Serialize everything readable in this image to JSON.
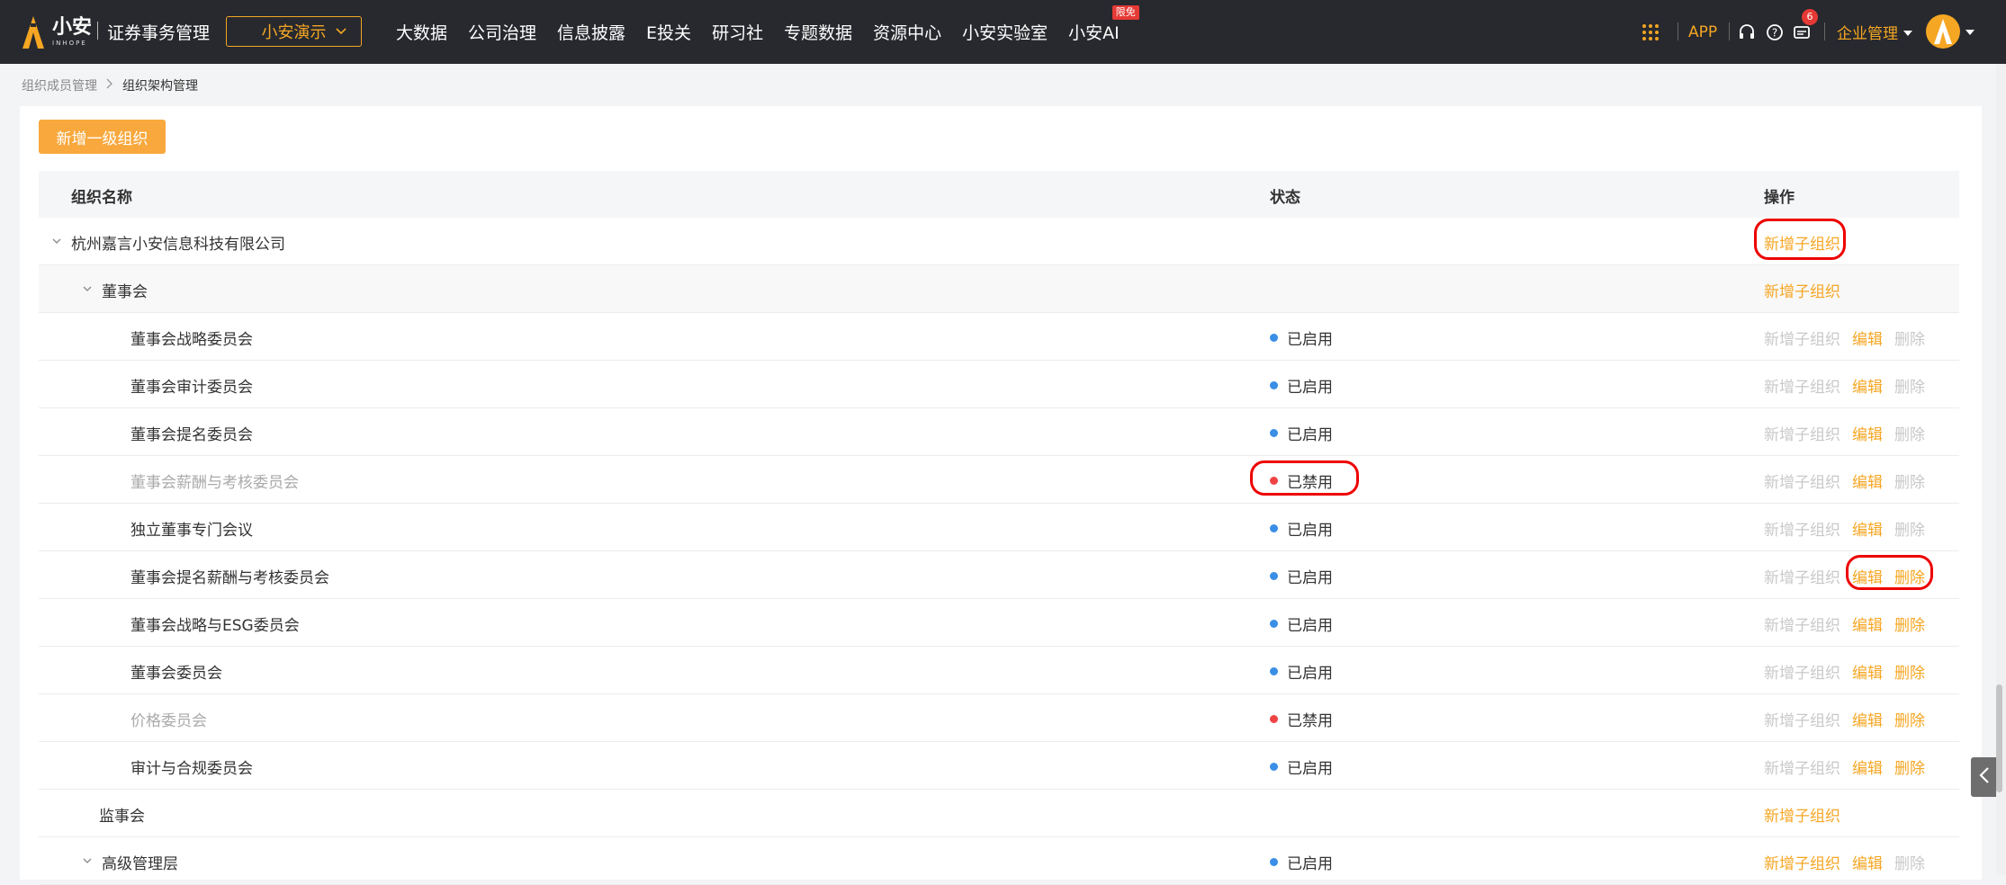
{
  "header": {
    "logo_text": "小安",
    "logo_sub": "INHOPE",
    "product_title": "证券事务管理",
    "company_selector": "小安演示",
    "nav": [
      "大数据",
      "公司治理",
      "信息披露",
      "E投关",
      "研习社",
      "专题数据",
      "资源中心",
      "小安实验室",
      "小安AI"
    ],
    "ai_badge": "限免",
    "app_label": "APP",
    "message_count": "6",
    "enterprise_menu": "企业管理"
  },
  "breadcrumb": {
    "parent": "组织成员管理",
    "current": "组织架构管理"
  },
  "toolbar": {
    "add_top_level": "新增一级组织"
  },
  "table": {
    "columns": {
      "name": "组织名称",
      "status": "状态",
      "actions": "操作"
    },
    "ops_labels": {
      "add_child": "新增子组织",
      "edit": "编辑",
      "delete": "删除"
    },
    "rows": [
      {
        "name": "杭州嘉言小安信息科技有限公司",
        "level": 0,
        "expand": true,
        "status": "",
        "status_kind": "",
        "add_child": "active",
        "edit": "none",
        "delete": "none"
      },
      {
        "name": "董事会",
        "level": 1,
        "expand": true,
        "status": "",
        "status_kind": "",
        "add_child": "active",
        "edit": "none",
        "delete": "none"
      },
      {
        "name": "董事会战略委员会",
        "level": 2,
        "expand": false,
        "status": "已启用",
        "status_kind": "enabled",
        "add_child": "disabled",
        "edit": "active",
        "delete": "disabled"
      },
      {
        "name": "董事会审计委员会",
        "level": 2,
        "expand": false,
        "status": "已启用",
        "status_kind": "enabled",
        "add_child": "disabled",
        "edit": "active",
        "delete": "disabled"
      },
      {
        "name": "董事会提名委员会",
        "level": 2,
        "expand": false,
        "status": "已启用",
        "status_kind": "enabled",
        "add_child": "disabled",
        "edit": "active",
        "delete": "disabled"
      },
      {
        "name": "董事会薪酬与考核委员会",
        "level": 2,
        "expand": false,
        "status": "已禁用",
        "status_kind": "disabled",
        "add_child": "disabled",
        "edit": "active",
        "delete": "disabled"
      },
      {
        "name": "独立董事专门会议",
        "level": 2,
        "expand": false,
        "status": "已启用",
        "status_kind": "enabled",
        "add_child": "disabled",
        "edit": "active",
        "delete": "disabled"
      },
      {
        "name": "董事会提名薪酬与考核委员会",
        "level": 2,
        "expand": false,
        "status": "已启用",
        "status_kind": "enabled",
        "add_child": "disabled",
        "edit": "active",
        "delete": "active"
      },
      {
        "name": "董事会战略与ESG委员会",
        "level": 2,
        "expand": false,
        "status": "已启用",
        "status_kind": "enabled",
        "add_child": "disabled",
        "edit": "active",
        "delete": "active"
      },
      {
        "name": "董事会委员会",
        "level": 2,
        "expand": false,
        "status": "已启用",
        "status_kind": "enabled",
        "add_child": "disabled",
        "edit": "active",
        "delete": "active"
      },
      {
        "name": "价格委员会",
        "level": 2,
        "expand": false,
        "status": "已禁用",
        "status_kind": "disabled",
        "add_child": "disabled",
        "edit": "active",
        "delete": "active"
      },
      {
        "name": "审计与合规委员会",
        "level": 2,
        "expand": false,
        "status": "已启用",
        "status_kind": "enabled",
        "add_child": "disabled",
        "edit": "active",
        "delete": "active"
      },
      {
        "name": "监事会",
        "level": 1,
        "expand": false,
        "status": "",
        "status_kind": "",
        "add_child": "active",
        "edit": "none",
        "delete": "none"
      },
      {
        "name": "高级管理层",
        "level": 1,
        "expand": true,
        "status": "已启用",
        "status_kind": "enabled",
        "add_child": "active",
        "edit": "active",
        "delete": "disabled"
      }
    ]
  },
  "colors": {
    "accent": "#f5a623",
    "enabled_dot": "#3a8ee6",
    "disabled_dot": "#ef4444",
    "topbar": "#27292e",
    "highlight": "#ee0000"
  }
}
